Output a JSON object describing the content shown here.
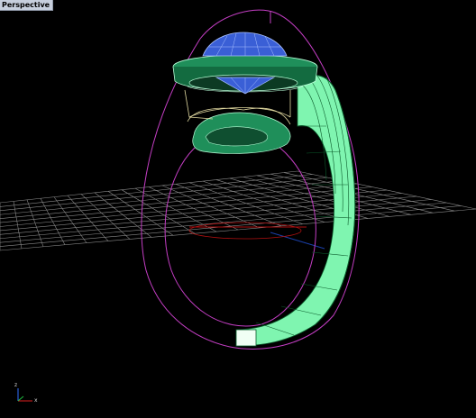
{
  "viewport": {
    "title": "Perspective",
    "background": "#000000"
  },
  "colors": {
    "grid": "#8a8a8a",
    "grid_axis_x": "#b01010",
    "grid_axis_y": "#1a3fa8",
    "construction_curve": "#c43ec4",
    "shank_surface": "#7ff5b0",
    "shank_edges": "#0a5a2a",
    "bezel_surface": "#1f8f5a",
    "bezel_edges": "#b8ffd8",
    "gem_surface": "#3a5fd6",
    "gem_edges": "#a8c0ff",
    "setting_outline": "#e0d8a0"
  },
  "axis_widget": {
    "x_label": "x",
    "z_label": "z"
  }
}
